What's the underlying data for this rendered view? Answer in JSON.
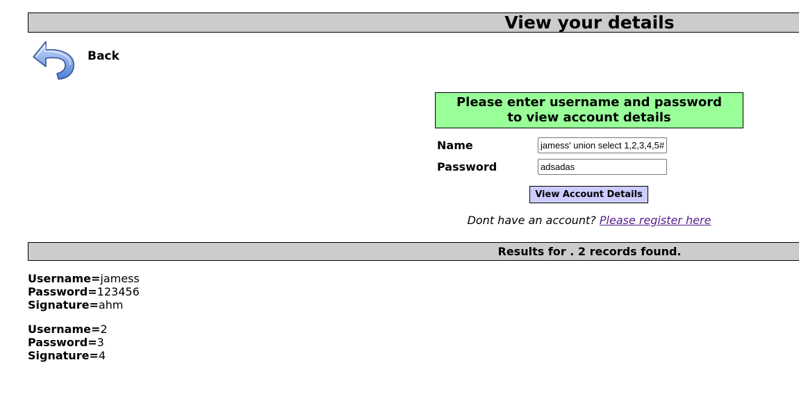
{
  "page": {
    "title": "View your details"
  },
  "back": {
    "label": "Back",
    "icon": "back-arrow-icon"
  },
  "login": {
    "header_line1": "Please enter username and password",
    "header_line2": "to view account details",
    "name_label": "Name",
    "name_value": "jamess' union select 1,2,3,4,5#",
    "password_label": "Password",
    "password_value": "adsadas",
    "submit_label": "View Account Details",
    "register_prompt": "Dont have an account?",
    "register_link": "Please register here"
  },
  "results": {
    "summary": "Results for . 2 records found.",
    "username_label": "Username=",
    "password_label": "Password=",
    "signature_label": "Signature=",
    "records": [
      {
        "username": "jamess",
        "password": "123456",
        "signature": "ahm"
      },
      {
        "username": "2",
        "password": "3",
        "signature": "4"
      }
    ]
  },
  "colors": {
    "bar_gray": "#cccccc",
    "login_header_green": "#99ff99",
    "button_lavender": "#ccccff",
    "link_visited": "#551a8b"
  }
}
